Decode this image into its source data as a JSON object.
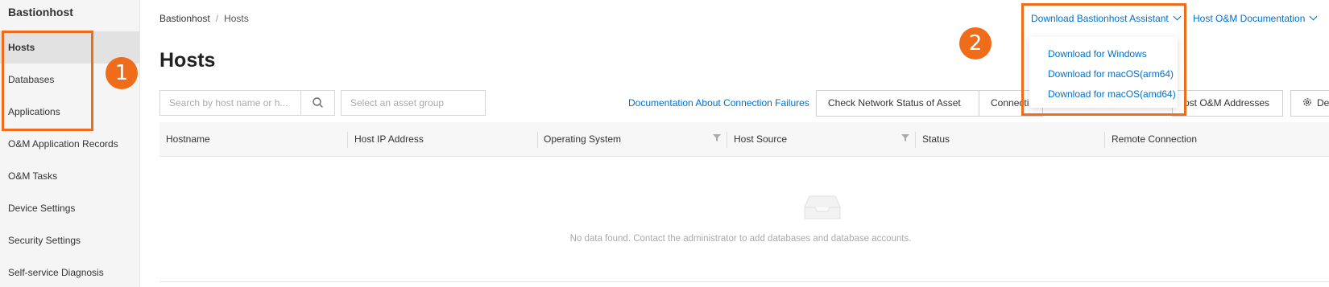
{
  "sidebar": {
    "brand": "Bastionhost",
    "items": [
      {
        "label": "Hosts"
      },
      {
        "label": "Databases"
      },
      {
        "label": "Applications"
      },
      {
        "label": "O&M Application Records"
      },
      {
        "label": "O&M Tasks"
      },
      {
        "label": "Device Settings"
      },
      {
        "label": "Security Settings"
      },
      {
        "label": "Self-service Diagnosis"
      }
    ]
  },
  "callouts": {
    "one": "1",
    "two": "2",
    "color": "#ef6c1b"
  },
  "breadcrumb": {
    "root": "Bastionhost",
    "separator": "/",
    "current": "Hosts"
  },
  "page_title": "Hosts",
  "header_links": {
    "download_assistant": "Download Bastionhost Assistant",
    "om_docs": "Host O&M Documentation"
  },
  "download_menu": {
    "items": [
      "Download for Windows",
      "Download for macOS(arm64)",
      "Download for macOS(amd64)"
    ]
  },
  "toolbar": {
    "search_placeholder": "Search by host name or h...",
    "asset_group_placeholder": "Select an asset group",
    "doc_link": "Documentation About Connection Failures",
    "check_network": "Check Network Status of Asset",
    "connection_btn": "Connectio",
    "om_addresses": "ost O&M Addresses",
    "settings_btn": "De"
  },
  "table": {
    "columns": [
      "Hostname",
      "Host IP Address",
      "Operating System",
      "Host Source",
      "Status",
      "Remote Connection"
    ],
    "empty_text": "No data found. Contact the administrator to add databases and database accounts."
  },
  "colors": {
    "link": "#0070cc",
    "accent": "#ef6c1b",
    "sidebar_bg": "#f5f5f5"
  }
}
